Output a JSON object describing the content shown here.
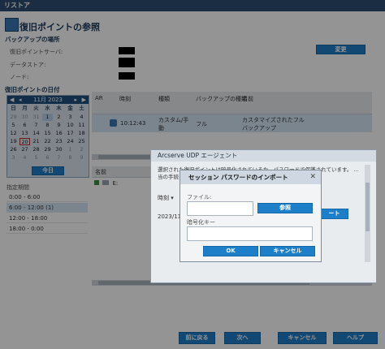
{
  "window": {
    "title": "リストア"
  },
  "header": {
    "title": "復旧ポイントの参照"
  },
  "backup_location": {
    "label": "バックアップの場所",
    "server_label": "復旧ポイントサーバ:",
    "datastore_label": "データストア:",
    "node_label": "ノード:",
    "change_button": "変更"
  },
  "recovery_date": {
    "label": "復旧ポイントの日付",
    "calendar": {
      "month_label": "11月 2023",
      "prev": "◀",
      "next": "▶",
      "prev_year": "◂",
      "next_year": "▸",
      "weekdays": [
        "日",
        "月",
        "火",
        "水",
        "木",
        "金",
        "土"
      ],
      "weeks": [
        [
          "29",
          "30",
          "31",
          "1",
          "2",
          "3",
          "4"
        ],
        [
          "5",
          "6",
          "7",
          "8",
          "9",
          "10",
          "11"
        ],
        [
          "12",
          "13",
          "14",
          "15",
          "16",
          "17",
          "18"
        ],
        [
          "19",
          "20",
          "21",
          "22",
          "23",
          "24",
          "25"
        ],
        [
          "26",
          "27",
          "28",
          "29",
          "30",
          "1",
          "2"
        ],
        [
          "3",
          "4",
          "5",
          "6",
          "7",
          "8",
          "9"
        ]
      ],
      "today_button": "今日"
    }
  },
  "period": {
    "label": "指定期間",
    "items": [
      "0:00 - 6:00",
      "6:00 - 12:00 (1)",
      "12:00 - 18:00",
      "18:00 - 0:00"
    ]
  },
  "points_table": {
    "headers": [
      "AR",
      "時刻",
      "種類",
      "バックアップの種類",
      "名前"
    ],
    "rows": [
      {
        "time": "10:12:43",
        "type": "カスタム/手動",
        "backup_type": "フル",
        "name": "カスタマイズされたフル バックアップ"
      }
    ]
  },
  "name_table": {
    "header": "名前",
    "items": [
      "E:"
    ]
  },
  "agent_dialog": {
    "title": "Arcserve UDP エージェント",
    "message": "選択された復旧ポイントは暗号化されているか、パスワードで保護されています。 ... 当の手続きが ... 入力する必要があります。",
    "time_header": "時刻",
    "date_value": "2023/11/20",
    "ok_button": "ート"
  },
  "session_dialog": {
    "title": "セッション パスワードのインポート",
    "file_label": "ファイル:",
    "file_value": "",
    "browse_button": "参照",
    "key_label": "暗号化キー",
    "key_value": "",
    "ok_button": "OK",
    "cancel_button": "キャンセル"
  },
  "footer": {
    "back_button": "前に戻る",
    "next_button": "次へ",
    "cancel_button": "キャンセル",
    "help_button": "ヘルプ"
  },
  "colors": {
    "accent": "#1e7fc9",
    "titlebar": "#2d4f73",
    "calendar_header": "#1e4f7d"
  }
}
